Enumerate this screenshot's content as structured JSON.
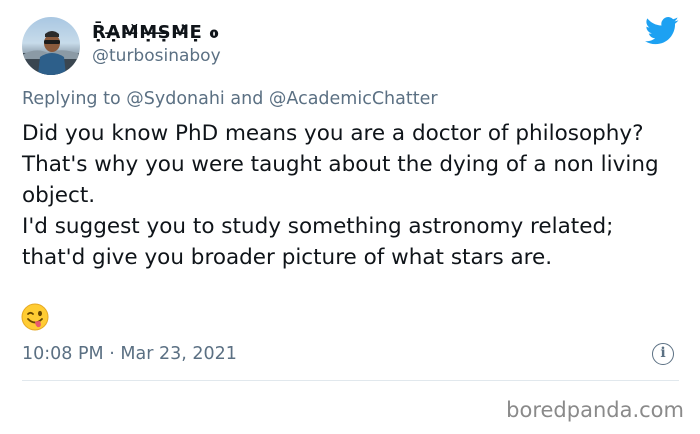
{
  "author": {
    "display_name": "ṜẠ̶M̶̆Ṃ̶Ṣ̶M̶̈Ẹ ߋ",
    "handle": "@turbosinaboy",
    "avatar_icon": "profile-photo"
  },
  "replying": {
    "prefix": "Replying to",
    "mention_1": "@Sydonahi",
    "joiner": "and",
    "mention_2": "@AcademicChatter"
  },
  "tweet": {
    "line_1": "Did you know PhD means you are a doctor of philosophy? That's why you were taught about the dying of a non living object.",
    "line_2": "I'd suggest you to study something astronomy related; that'd give you broader picture of what stars are.",
    "emoji": "winking-face-with-tongue",
    "time": "10:08 PM",
    "separator": "·",
    "date": "Mar 23, 2021"
  },
  "icons": {
    "platform": "twitter-bird-icon",
    "info": "info-icon"
  },
  "colors": {
    "brand": "#1da1f2",
    "secondary_text": "#5b7083",
    "primary_text": "#0f1419"
  },
  "watermark": "boredpanda.com"
}
